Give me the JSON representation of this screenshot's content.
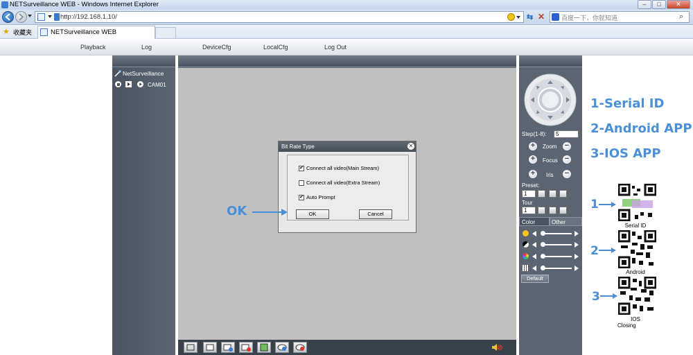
{
  "browser": {
    "title": "NETSurveillance WEB - Windows Internet Explorer",
    "url": "http://192.168.1.10/",
    "search_placeholder": "百度一下，你就知道",
    "favorites_label": "收藏夹",
    "tab_title": "NETSurveillance WEB"
  },
  "menu": {
    "items": [
      {
        "label": "Playback"
      },
      {
        "label": "Log"
      },
      {
        "label": "DeviceCfg"
      },
      {
        "label": "LocalCfg"
      },
      {
        "label": "Log Out"
      }
    ]
  },
  "left_panel": {
    "root_label": "NetSurveillance",
    "camera_label": "CAM01"
  },
  "dialog": {
    "title": "Bit Rate Type",
    "options": [
      {
        "label": "Connect all video(Main Stream)",
        "checked": true
      },
      {
        "label": "Connect all video(Extra Stream)",
        "checked": false
      },
      {
        "label": "Auto Prompt",
        "checked": true
      }
    ],
    "ok_label": "OK",
    "cancel_label": "Cancel"
  },
  "ptz": {
    "step_label": "Step(1-8):",
    "step_value": "5",
    "zoom_label": "Zoom",
    "focus_label": "Focus",
    "iris_label": "Iris",
    "preset_label": "Preset:",
    "preset_value": "1",
    "tour_label": "Tour",
    "tour_value": "1",
    "tab_color": "Color",
    "tab_other": "Other",
    "default_label": "Default"
  },
  "annotations": {
    "ok_callout": "OK",
    "list": [
      "1-Serial ID",
      "2-Android APP",
      "3-IOS APP"
    ],
    "qr_numbers": [
      "1",
      "2",
      "3"
    ],
    "qr_captions": [
      "Serial ID",
      "Android",
      "IOS"
    ],
    "closing": "Closing",
    "accent_color": "#4a8fd8"
  }
}
